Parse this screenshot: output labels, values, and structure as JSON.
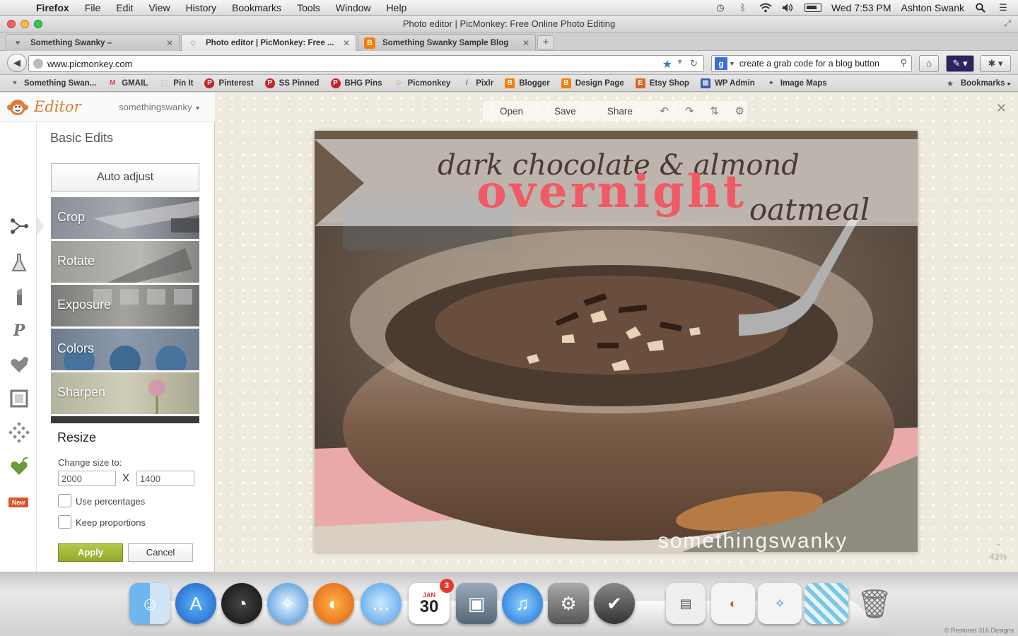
{
  "menubar": {
    "app": "Firefox",
    "items": [
      "File",
      "Edit",
      "View",
      "History",
      "Bookmarks",
      "Tools",
      "Window",
      "Help"
    ],
    "clock": "Wed 7:53 PM",
    "user": "Ashton Swank"
  },
  "window": {
    "title": "Photo editor | PicMonkey: Free Online Photo Editing"
  },
  "tabs": [
    {
      "label": "Something Swanky –",
      "icon": "heart-icon"
    },
    {
      "label": "Photo editor | PicMonkey: Free ...",
      "icon": "picmonkey-icon"
    },
    {
      "label": "Something Swanky Sample Blog",
      "icon": "blogger-icon"
    }
  ],
  "nav": {
    "url": "www.picmonkey.com",
    "search": "create a grab code for a blog button"
  },
  "bookmarks": [
    {
      "label": "Something Swan...",
      "icon": "heart-icon",
      "color": "#8a6a4a"
    },
    {
      "label": "GMAIL",
      "icon": "gmail-icon",
      "color": "#d44"
    },
    {
      "label": "Pin It",
      "icon": "dotted-square-icon",
      "color": "#999"
    },
    {
      "label": "Pinterest",
      "icon": "pinterest-icon",
      "color": "#cb2027"
    },
    {
      "label": "SS Pinned",
      "icon": "pinterest-icon",
      "color": "#cb2027"
    },
    {
      "label": "BHG Pins",
      "icon": "pinterest-icon",
      "color": "#cb2027"
    },
    {
      "label": "Picmonkey",
      "icon": "picmonkey-icon",
      "color": "#e07a35"
    },
    {
      "label": "Pixlr",
      "icon": "brush-icon",
      "color": "#666"
    },
    {
      "label": "Blogger",
      "icon": "blogger-icon",
      "color": "#f57d00"
    },
    {
      "label": "Design Page",
      "icon": "blogger-icon",
      "color": "#f57d00"
    },
    {
      "label": "Etsy Shop",
      "icon": "etsy-icon",
      "color": "#e0621f"
    },
    {
      "label": "WP Admin",
      "icon": "grid-icon",
      "color": "#3a5ea8"
    },
    {
      "label": "Image Maps",
      "icon": "image-maps-icon",
      "color": "#555"
    }
  ],
  "bookmarks_menu": "Bookmarks",
  "editor": {
    "app_name": "Editor",
    "user": "somethingswanky",
    "panel_title": "Basic Edits",
    "auto_adjust": "Auto adjust",
    "tools": [
      "Crop",
      "Rotate",
      "Exposure",
      "Colors",
      "Sharpen"
    ],
    "rail_new_badge": "New",
    "resize": {
      "title": "Resize",
      "subtitle": "Change size to:",
      "width": "2000",
      "height": "1400",
      "separator": "X",
      "use_percentages": "Use percentages",
      "keep_proportions": "Keep proportions",
      "use_percentages_checked": false,
      "keep_proportions_checked": false,
      "apply": "Apply",
      "cancel": "Cancel"
    },
    "top_menu": [
      "Open",
      "Save",
      "Share"
    ],
    "zoom": "43%"
  },
  "photo": {
    "line1": "dark chocolate & almond",
    "line2": "overnight",
    "line3": "oatmeal",
    "watermark": "somethingswanky"
  },
  "dock": {
    "calendar_month": "JAN",
    "calendar_day": "30",
    "calendar_badge": "3",
    "credit": "© Restored 316 Designs"
  },
  "colors": {
    "accent": "#e07a35",
    "apply_green": "#a3b838",
    "title_pink": "#ef5a64"
  }
}
